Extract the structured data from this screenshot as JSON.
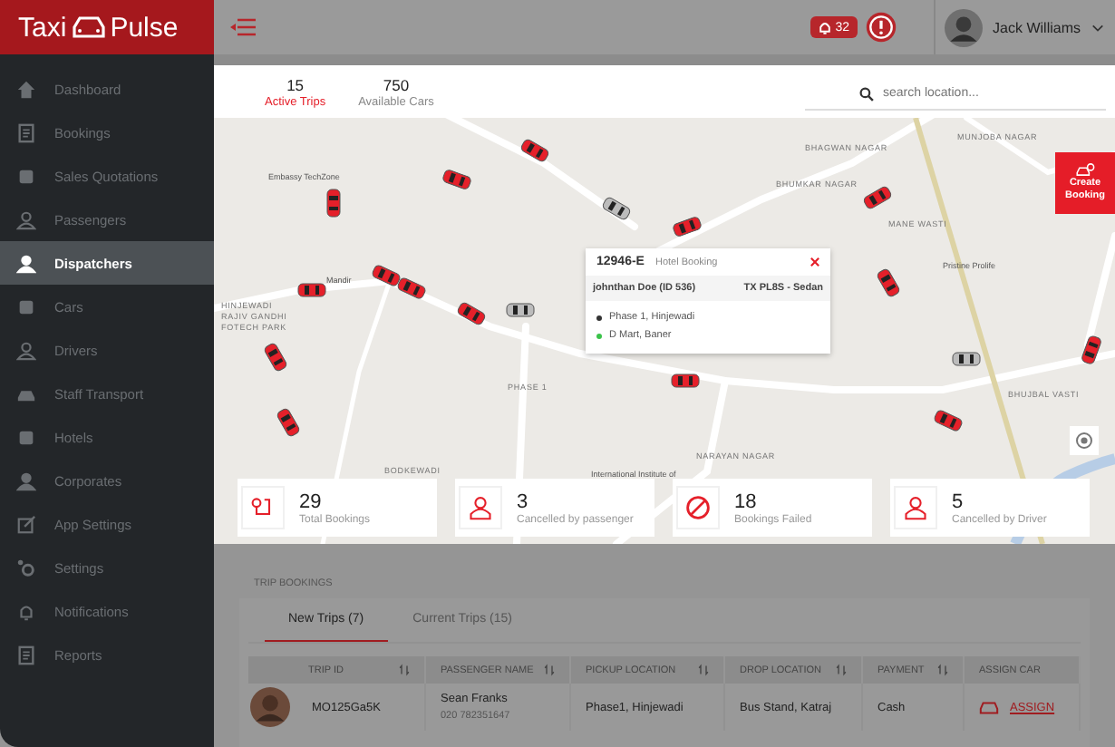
{
  "brand": {
    "left": "Taxi",
    "right": "Pulse"
  },
  "header": {
    "notification_count": "32",
    "user_name": "Jack Williams"
  },
  "sidebar": {
    "items": [
      {
        "label": "Dashboard",
        "selected": false
      },
      {
        "label": "Bookings",
        "selected": false
      },
      {
        "label": "Sales Quotations",
        "selected": false
      },
      {
        "label": "Passengers",
        "selected": false
      },
      {
        "label": "Dispatchers",
        "selected": true
      },
      {
        "label": "Cars",
        "selected": false
      },
      {
        "label": "Drivers",
        "selected": false
      },
      {
        "label": "Staff Transport",
        "selected": false
      },
      {
        "label": "Hotels",
        "selected": false
      },
      {
        "label": "Corporates",
        "selected": false
      },
      {
        "label": "App Settings",
        "selected": false
      },
      {
        "label": "Settings",
        "selected": false
      },
      {
        "label": "Notifications",
        "selected": false
      },
      {
        "label": "Reports",
        "selected": false
      }
    ]
  },
  "dispatch": {
    "tabs": [
      {
        "count": "15",
        "label": "Active Trips",
        "selected": true
      },
      {
        "count": "750",
        "label": "Available Cars",
        "selected": false
      }
    ],
    "search": {
      "placeholder": "search location..."
    }
  },
  "map": {
    "labels": [
      {
        "text": "Embassy TechZone",
        "kind": "poi"
      },
      {
        "text": "Mandir",
        "kind": "poi"
      },
      {
        "text": "HINJEWADI",
        "kind": "area"
      },
      {
        "text": "RAJIV GANDHI",
        "kind": "area"
      },
      {
        "text": "FOTECH PARK",
        "kind": "area"
      },
      {
        "text": "PHASE 1",
        "kind": "area"
      },
      {
        "text": "BODKEWADI",
        "kind": "area"
      },
      {
        "text": "NARAYAN NAGAR",
        "kind": "area"
      },
      {
        "text": "International Institute of",
        "kind": "poi"
      },
      {
        "text": "BHAGWAN NAGAR",
        "kind": "area"
      },
      {
        "text": "BHUMKAR NAGAR",
        "kind": "area"
      },
      {
        "text": "MUNJOBA NAGAR",
        "kind": "area"
      },
      {
        "text": "MANE WASTI",
        "kind": "area"
      },
      {
        "text": "Pristine Prolife",
        "kind": "poi"
      },
      {
        "text": "BHUJBAL VASTI",
        "kind": "area"
      }
    ],
    "popup": {
      "booking_id": "12946-E",
      "booking_type": "Hotel Booking",
      "passenger": "johnthan Doe (ID 536)",
      "vehicle": "TX PL8S - Sedan",
      "pickup": "Phase 1, Hinjewadi",
      "drop": "D Mart, Baner"
    },
    "create_button": "Create Booking"
  },
  "stats": [
    {
      "value": "29",
      "label": "Total Bookings"
    },
    {
      "value": "3",
      "label": "Cancelled by passenger"
    },
    {
      "value": "18",
      "label": "Bookings Failed"
    },
    {
      "value": "5",
      "label": "Cancelled by Driver"
    }
  ],
  "trip_bookings": {
    "title": "TRIP BOOKINGS",
    "tabs": [
      {
        "label": "New Trips (7)",
        "selected": true
      },
      {
        "label": "Current Trips (15)",
        "selected": false
      }
    ],
    "columns": [
      {
        "label": "TRIP ID",
        "sortable": true
      },
      {
        "label": "PASSENGER NAME",
        "sortable": true
      },
      {
        "label": "PICKUP LOCATION",
        "sortable": true
      },
      {
        "label": "DROP LOCATION",
        "sortable": true
      },
      {
        "label": "PAYMENT",
        "sortable": true
      },
      {
        "label": "ASSIGN CAR",
        "sortable": false
      }
    ],
    "rows": [
      {
        "trip_id": "MO125Ga5K",
        "passenger_name": "Sean Franks",
        "phone": "020 782351647",
        "pickup": "Phase1, Hinjewadi",
        "drop": "Bus Stand, Katraj",
        "payment": "Cash",
        "action": "ASSIGN"
      }
    ]
  }
}
